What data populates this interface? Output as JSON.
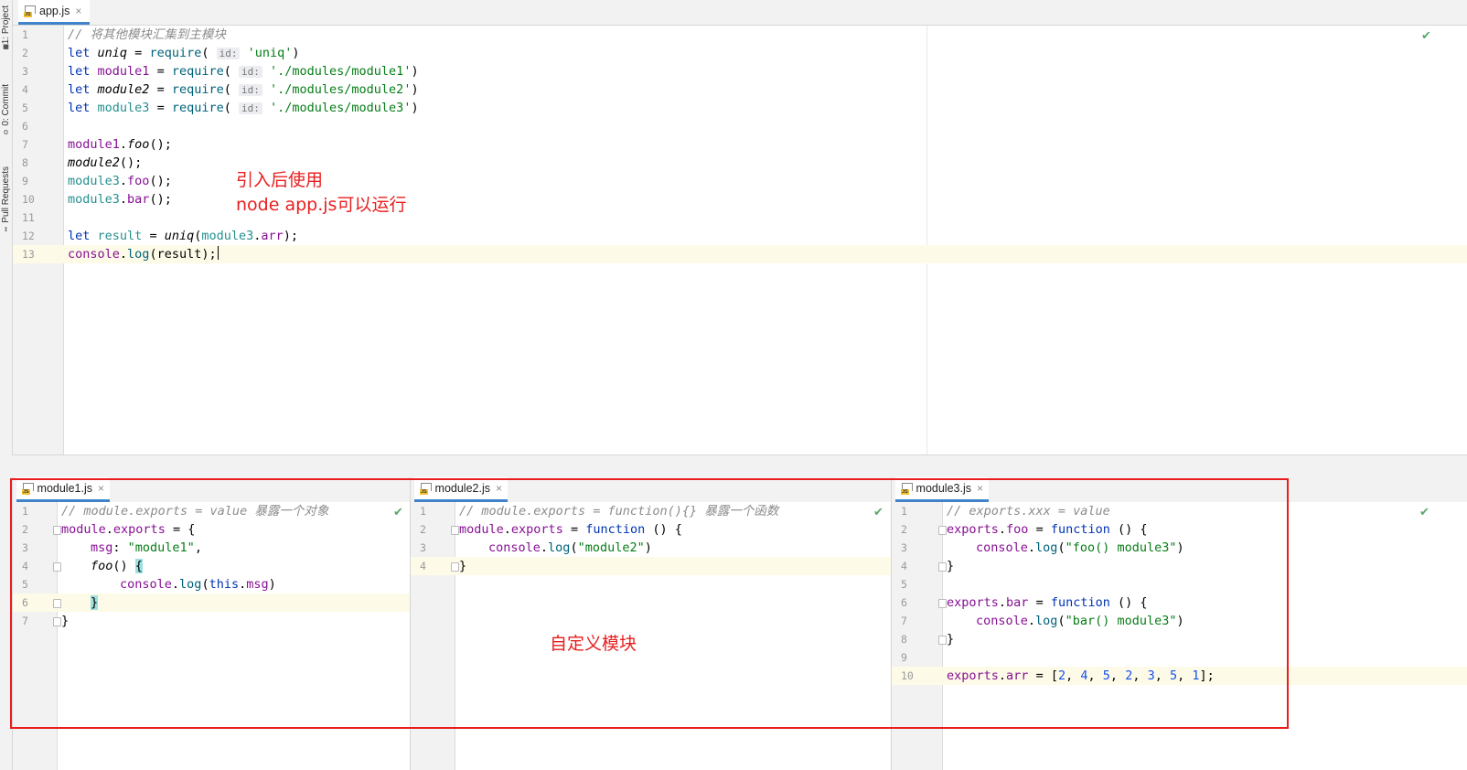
{
  "side_tabs": [
    {
      "label": "1: Project",
      "icon": "folder-icon"
    },
    {
      "label": "0: Commit",
      "icon": "commit-icon"
    },
    {
      "label": "Pull Requests",
      "icon": "pull-request-icon"
    }
  ],
  "app_tab": {
    "label": "app.js",
    "close": "×"
  },
  "app_lines": [
    "1",
    "2",
    "3",
    "4",
    "5",
    "6",
    "7",
    "8",
    "9",
    "10",
    "11",
    "12",
    "13"
  ],
  "app_code": {
    "l1": "// 将其他模块汇集到主模块",
    "kw_let": "let",
    "uniq": "uniq",
    "module1": "module1",
    "module2": "module2",
    "module3": "module3",
    "result": "result",
    "eq": " = ",
    "require": "require",
    "open_paren": "( ",
    "hint_id": "id:",
    "uniq_str": "'uniq'",
    "m1_str": "'./modules/module1'",
    "m2_str": "'./modules/module2'",
    "m3_str": "'./modules/module3'",
    "close_paren": ")",
    "dot": ".",
    "foo": "foo",
    "bar": "bar",
    "call_end": "();",
    "uniq_call": "uniq",
    "arr": "arr",
    "paren_open": "(",
    "end_paren": ");",
    "console": "console",
    "log": "log",
    "result_arg": "(result);"
  },
  "annotations": {
    "top_line1": "引入后使用",
    "top_line2": "node app.js可以运行",
    "bottom": "自定义模块"
  },
  "pane1": {
    "tab": "module1.js",
    "lines": [
      "1",
      "2",
      "3",
      "4",
      "5",
      "6",
      "7"
    ],
    "c1": "// module.exports = value 暴露一个对象",
    "module": "module",
    "exports": "exports",
    "eq_brace": " = {",
    "msg": "msg",
    "colon": ": ",
    "msg_val": "\"module1\"",
    "comma": ",",
    "foo": "foo",
    "parens_sp": "() ",
    "open_brace": "{",
    "console": "console",
    "log": "log",
    "paren": "(",
    "this": "this",
    "dot": ".",
    "msg2": "msg",
    "close": ")",
    "close_brace": "}"
  },
  "pane2": {
    "tab": "module2.js",
    "lines": [
      "1",
      "2",
      "3",
      "4"
    ],
    "c1": "// module.exports = function(){} 暴露一个函数",
    "module": "module",
    "exports": "exports",
    "eq": " = ",
    "function": "function",
    "tail": " () {",
    "console": "console",
    "log": "log",
    "arg": "(",
    "str": "\"module2\"",
    "close": ")",
    "close_brace": "}"
  },
  "pane3": {
    "tab": "module3.js",
    "lines": [
      "1",
      "2",
      "3",
      "4",
      "5",
      "6",
      "7",
      "8",
      "9",
      "10"
    ],
    "c1": "// exports.xxx = value",
    "exports": "exports",
    "dot": ".",
    "foo": "foo",
    "bar": "bar",
    "arr": "arr",
    "eq": " = ",
    "function": "function",
    "tail": " () {",
    "console": "console",
    "log": "log",
    "paren": "(",
    "foo_str": "\"foo() module3\"",
    "bar_str": "\"bar() module3\"",
    "close": ")",
    "close_brace": "}",
    "arr_open": "[",
    "n1": "2",
    "n2": "4",
    "n3": "5",
    "n4": "2",
    "n5": "3",
    "n6": "5",
    "n7": "1",
    "sep": ", ",
    "arr_close": "];"
  },
  "colors": {
    "accent": "#4083c9",
    "annotation": "#e81e1e",
    "inspection_ok": "#59a869"
  }
}
